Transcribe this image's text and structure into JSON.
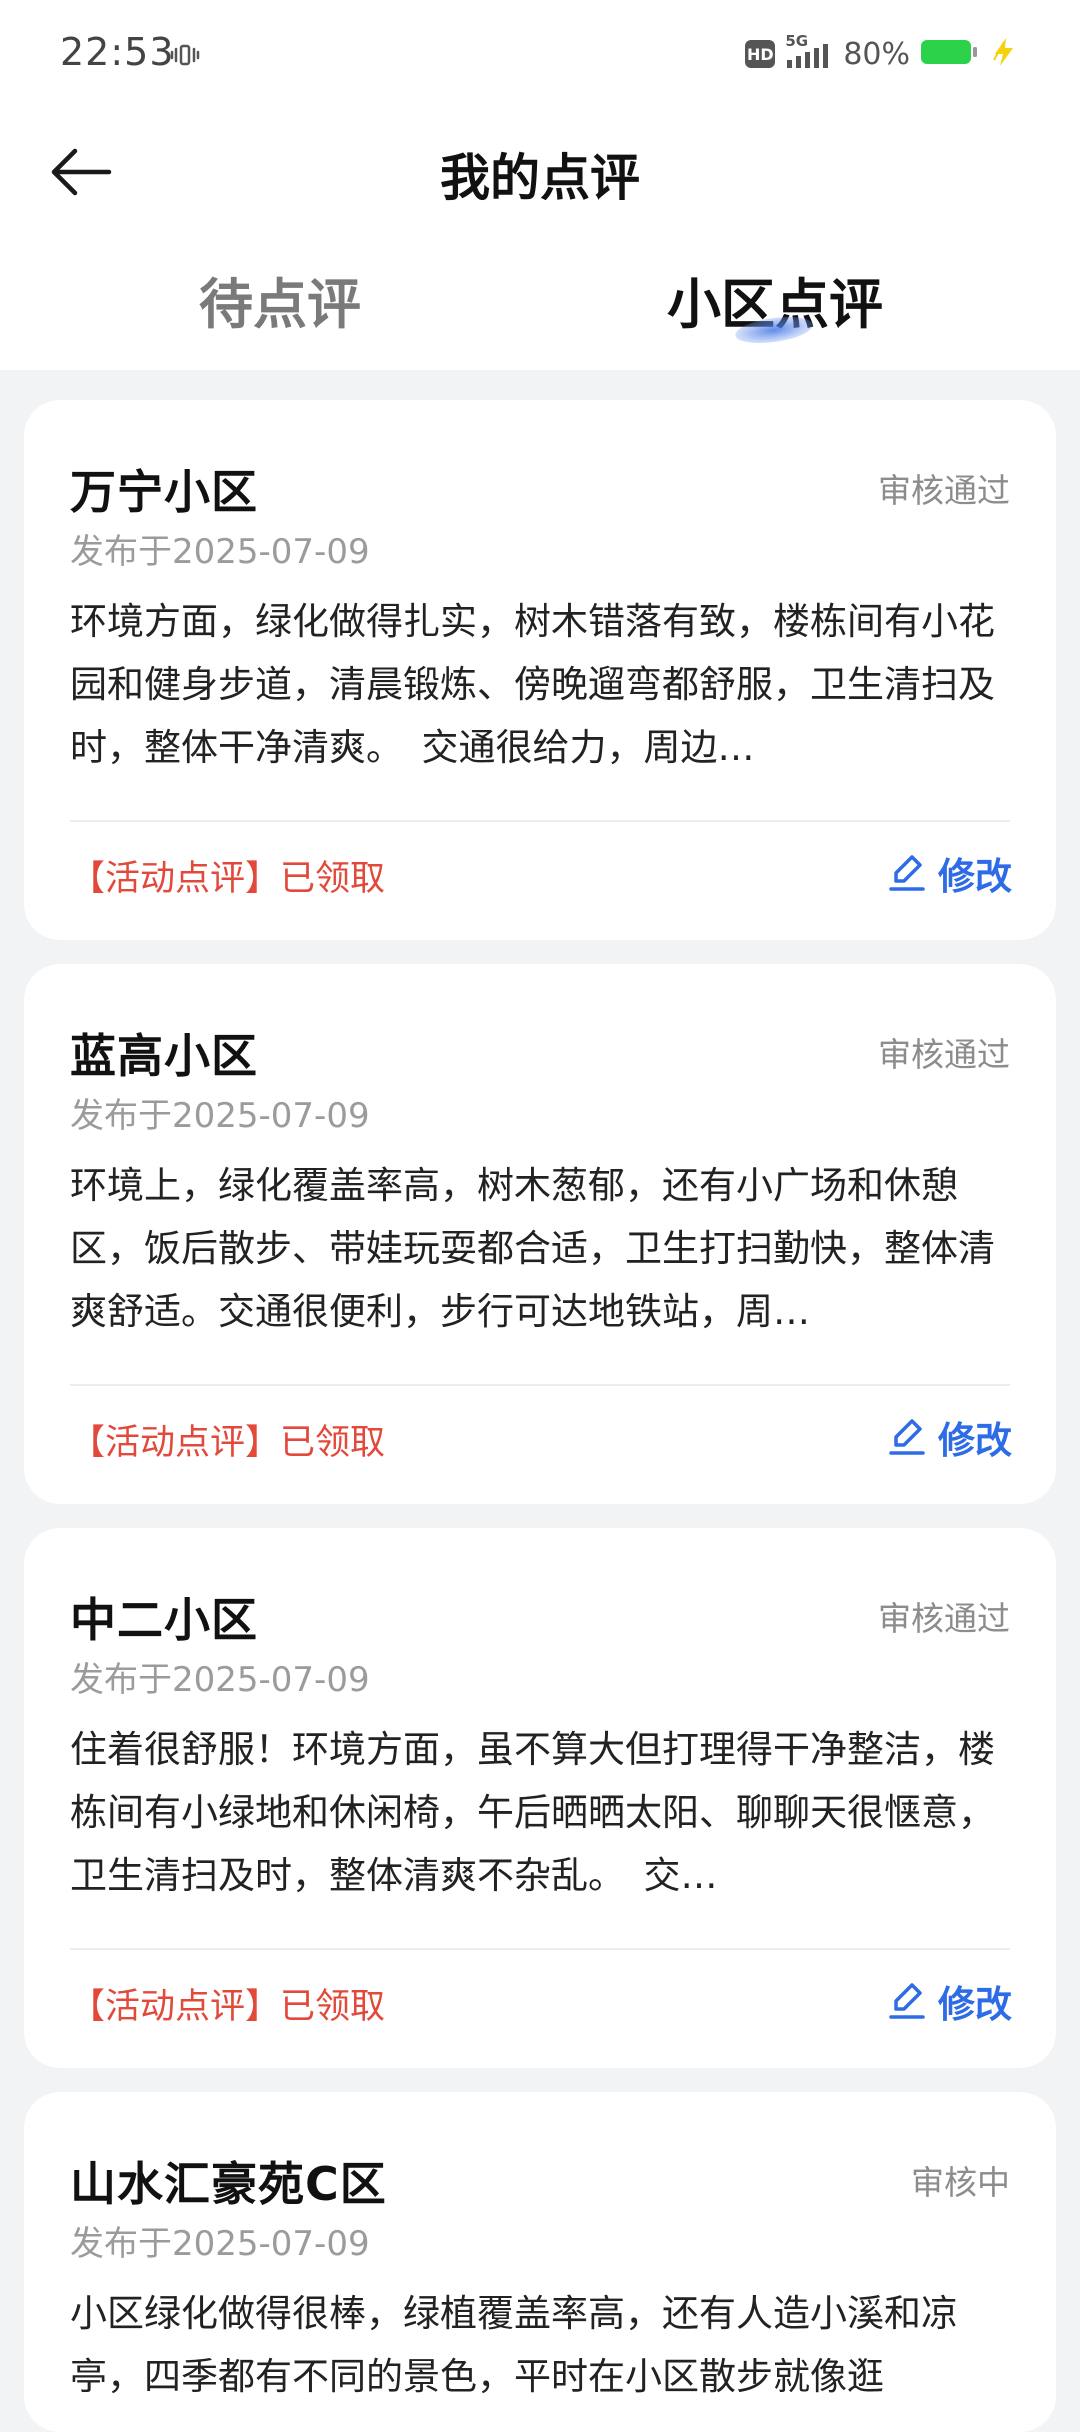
{
  "status_bar": {
    "time": "22:53",
    "network": "5G",
    "hd": "HD",
    "battery": "80%"
  },
  "header": {
    "title": "我的点评"
  },
  "tabs": [
    {
      "label": "待点评",
      "active": false
    },
    {
      "label": "小区点评",
      "active": true
    }
  ],
  "reviews": [
    {
      "name": "万宁小区",
      "status": "审核通过",
      "date": "发布于2025-07-09",
      "text": "环境方面，绿化做得扎实，树木错落有致，楼栋间有小花园和健身步道，清晨锻炼、傍晚遛弯都舒服，卫生清扫及时，整体干净清爽。　交通很给力，周边…",
      "tag": "【活动点评】已领取",
      "edit": "修改"
    },
    {
      "name": "蓝高小区",
      "status": "审核通过",
      "date": "发布于2025-07-09",
      "text": "环境上，绿化覆盖率高，树木葱郁，还有小广场和休憩区，饭后散步、带娃玩耍都合适，卫生打扫勤快，整体清爽舒适。交通很便利，步行可达地铁站，周…",
      "tag": "【活动点评】已领取",
      "edit": "修改"
    },
    {
      "name": "中二小区",
      "status": "审核通过",
      "date": "发布于2025-07-09",
      "text": "住着很舒服！环境方面，虽不算大但打理得干净整洁，楼栋间有小绿地和休闲椅，午后晒晒太阳、聊聊天很惬意，卫生清扫及时，整体清爽不杂乱。　交…",
      "tag": "【活动点评】已领取",
      "edit": "修改"
    },
    {
      "name": "山水汇豪苑C区",
      "status": "审核中",
      "date": "发布于2025-07-09",
      "text": "小区绿化做得很棒，绿植覆盖率高，还有人造小溪和凉亭，四季都有不同的景色，平时在小区散步就像逛",
      "tag": "",
      "edit": ""
    }
  ],
  "colors": {
    "accent": "#2e6be6",
    "tag": "#e2493a",
    "background": "#f2f3f5",
    "battery": "#2bd34b"
  }
}
